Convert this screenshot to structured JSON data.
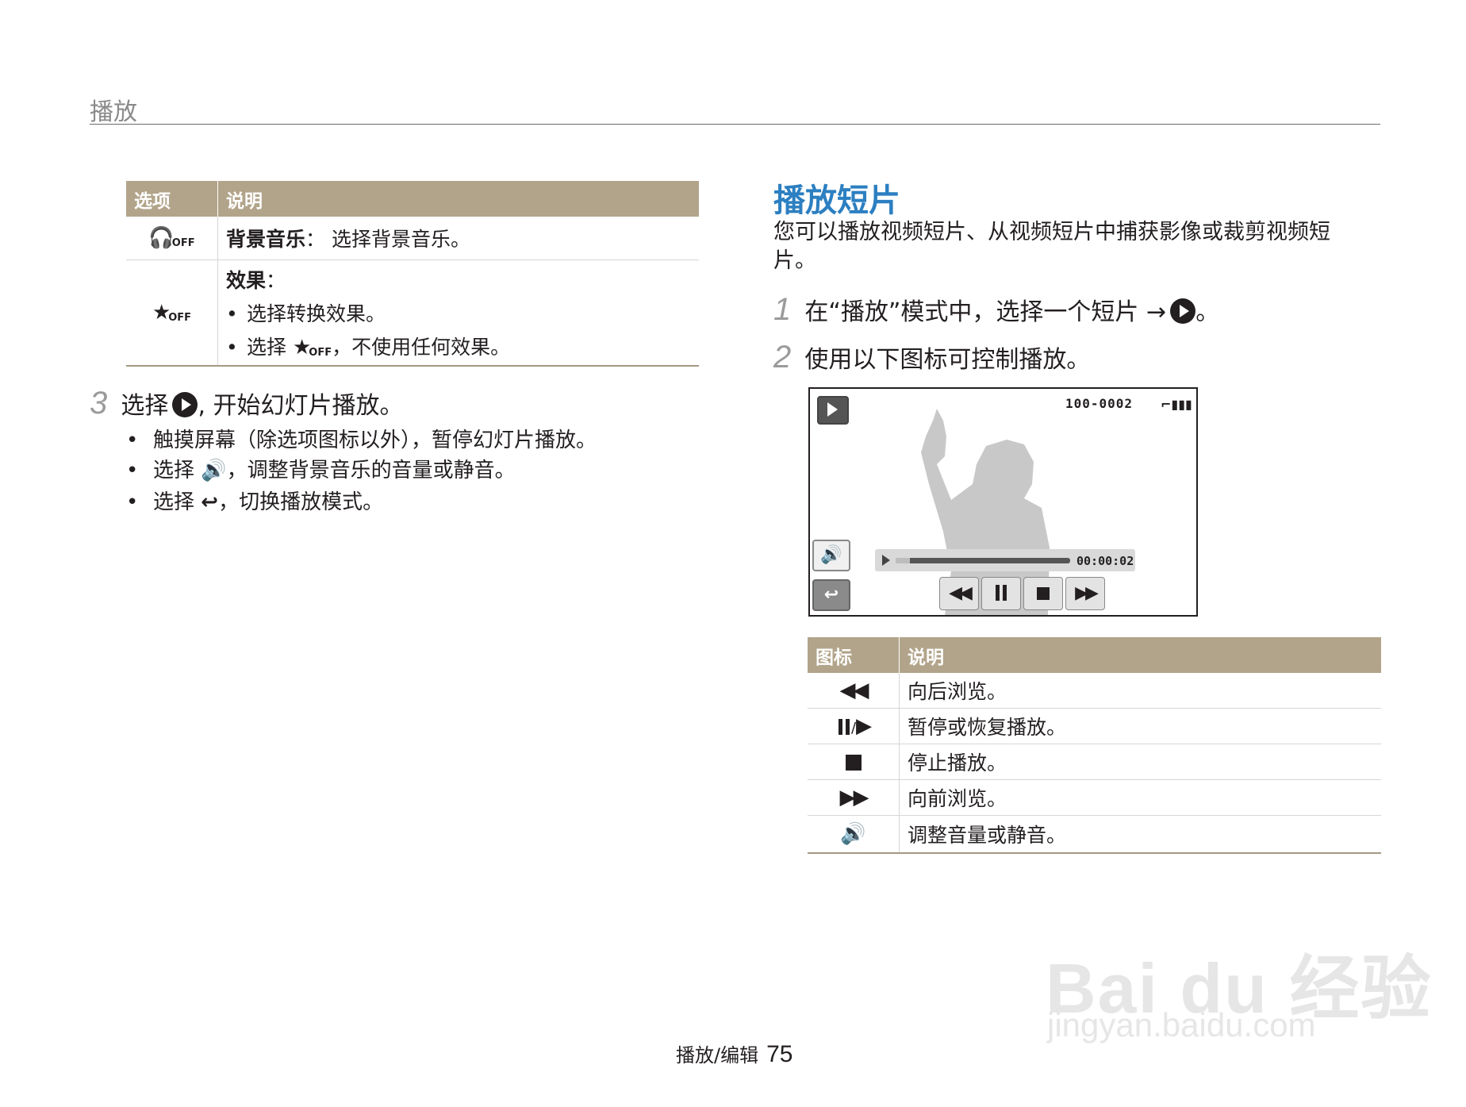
{
  "header": {
    "title": "播放"
  },
  "options_table": {
    "headers": [
      "选项",
      "说明"
    ],
    "rows": [
      {
        "icon": "bgm-off-icon",
        "title": "背景音乐",
        "text": "选择背景音乐。"
      },
      {
        "icon": "effect-off-icon",
        "title": "效果",
        "bullets": [
          "选择转换效果。",
          "选择",
          "，不使用任何效果。"
        ]
      }
    ]
  },
  "step3": {
    "num": "3",
    "text_before": "选择",
    "text_after": ", 开始幻灯片播放。",
    "bullets": [
      "触摸屏幕（除选项图标以外），暂停幻灯片播放。",
      "选择",
      "，调整背景音乐的音量或静音。",
      "选择",
      "，切换播放模式。"
    ]
  },
  "section": {
    "title": "播放短片",
    "intro": "您可以播放视频短片、从视频短片中捕获影像或裁剪视频短片。"
  },
  "steps": [
    {
      "num": "1",
      "text": "在“播放”模式中，选择一个短片 →",
      "suffix": "。"
    },
    {
      "num": "2",
      "text": "使用以下图标可控制播放。"
    }
  ],
  "screen": {
    "counter": "100-0002",
    "time": "00:00:02",
    "progress": 0.08,
    "icons": [
      "play-mode-icon",
      "battery-icon",
      "volume-icon",
      "back-icon",
      "rewind-icon",
      "pause-icon",
      "stop-icon",
      "fast-forward-icon"
    ]
  },
  "icon_table": {
    "headers": [
      "图标",
      "说明"
    ],
    "rows": [
      {
        "icon": "rewind-icon",
        "text": "向后浏览。"
      },
      {
        "icon": "pause-play-icon",
        "text": "暂停或恢复播放。"
      },
      {
        "icon": "stop-icon",
        "text": "停止播放。"
      },
      {
        "icon": "fast-forward-icon",
        "text": "向前浏览。"
      },
      {
        "icon": "volume-icon",
        "text": "调整音量或静音。"
      }
    ]
  },
  "footer": {
    "section": "播放/编辑",
    "page": "75"
  },
  "watermark": {
    "logo": "Bai du 经验",
    "url": "jingyan.baidu.com"
  }
}
